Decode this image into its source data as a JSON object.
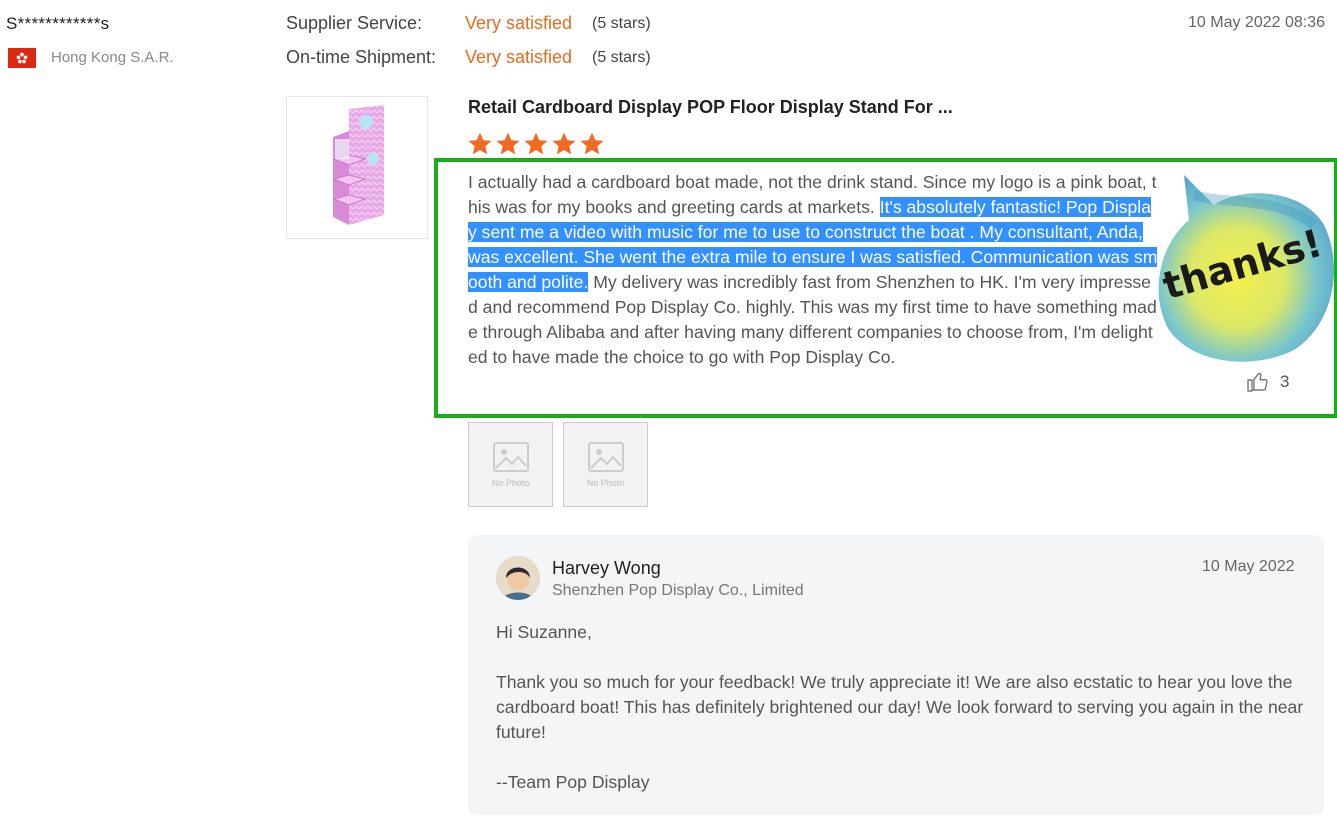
{
  "reviewer": {
    "name": "S************s",
    "country": "Hong Kong S.A.R."
  },
  "ratings": [
    {
      "label": "Supplier Service:",
      "value": "Very satisfied",
      "stars_text": "(5 stars)"
    },
    {
      "label": "On-time Shipment:",
      "value": "Very satisfied",
      "stars_text": "(5 stars)"
    }
  ],
  "review_date": "10 May 2022 08:36",
  "product": {
    "title": "Retail Cardboard Display POP Floor Display Stand For ...",
    "star_rating": 5
  },
  "review": {
    "text_before": "I actually had a cardboard boat made, not the drink stand. Since my logo is a pink boat, this was for my books and greeting cards at markets. ",
    "text_highlighted": "It's absolutely fantastic! Pop Display sent me a video with music for me to use to construct the boat . My consultant, Anda, was excellent. She went the extra mile to ensure I was satisfied. Communication was smooth and polite.",
    "text_after": " My delivery was incredibly fast from Shenzhen to HK. I'm very impressed and recommend Pop Display Co. highly. This was my first time to have something made through Alibaba and after having many different companies to choose from, I'm delighted to have made the choice to go with Pop Display Co.",
    "likes": "3",
    "sticker_text": "thanks!"
  },
  "photos": [
    {
      "label": "No Photo"
    },
    {
      "label": "No Photo"
    }
  ],
  "reply": {
    "name": "Harvey Wong",
    "company": "Shenzhen Pop Display Co., Limited",
    "date": "10 May 2022",
    "greeting": "Hi Suzanne,",
    "body": "Thank you so much for your feedback! We truly appreciate it! We are also ecstatic to hear you love the cardboard boat! This has definitely brightened our day! We look forward to serving you again in the near future!",
    "signoff": "--Team Pop Display"
  },
  "colors": {
    "accent_orange": "#e56b1f",
    "star_orange": "#f26a21",
    "highlight_box": "#1aac1a",
    "selection": "#3390ff"
  }
}
